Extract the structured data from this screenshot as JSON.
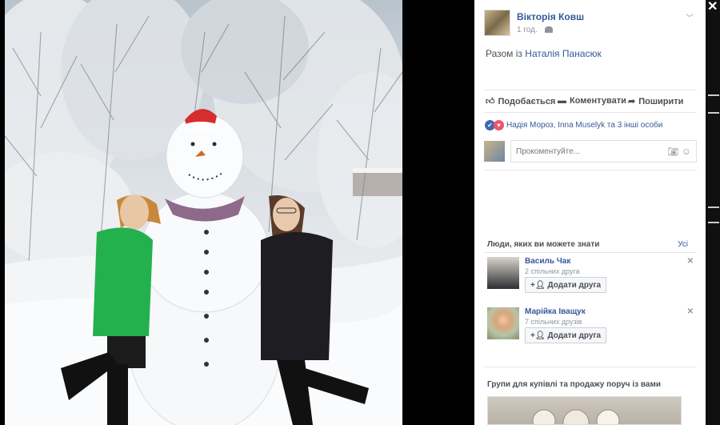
{
  "post": {
    "author": "Вікторія Ковш",
    "time": "1 год.",
    "with_prefix": "Разом із",
    "with_person": "Наталія Панасюк"
  },
  "actions": {
    "like": "Подобається",
    "comment": "Коментувати",
    "share": "Поширити"
  },
  "reactions": {
    "text": "Надія Мороз, Inna Muselyk та 3 інші особи"
  },
  "comment": {
    "placeholder": "Прокоментуйте..."
  },
  "pymk": {
    "title": "Люди, яких ви можете знати",
    "see_all": "Усі",
    "people": [
      {
        "name": "Василь Чак",
        "mutual": "2 спільних друга",
        "add_label": "Додати друга"
      },
      {
        "name": "Марійка Іващук",
        "mutual": "7 спільних друзів",
        "add_label": "Додати друга"
      }
    ]
  },
  "groups": {
    "title": "Групи для купівлі та продажу поруч із вами"
  },
  "colors": {
    "link": "#365899",
    "like_blue": "#4267b2",
    "love_red": "#f25268",
    "jacket_green": "#23b14d"
  }
}
